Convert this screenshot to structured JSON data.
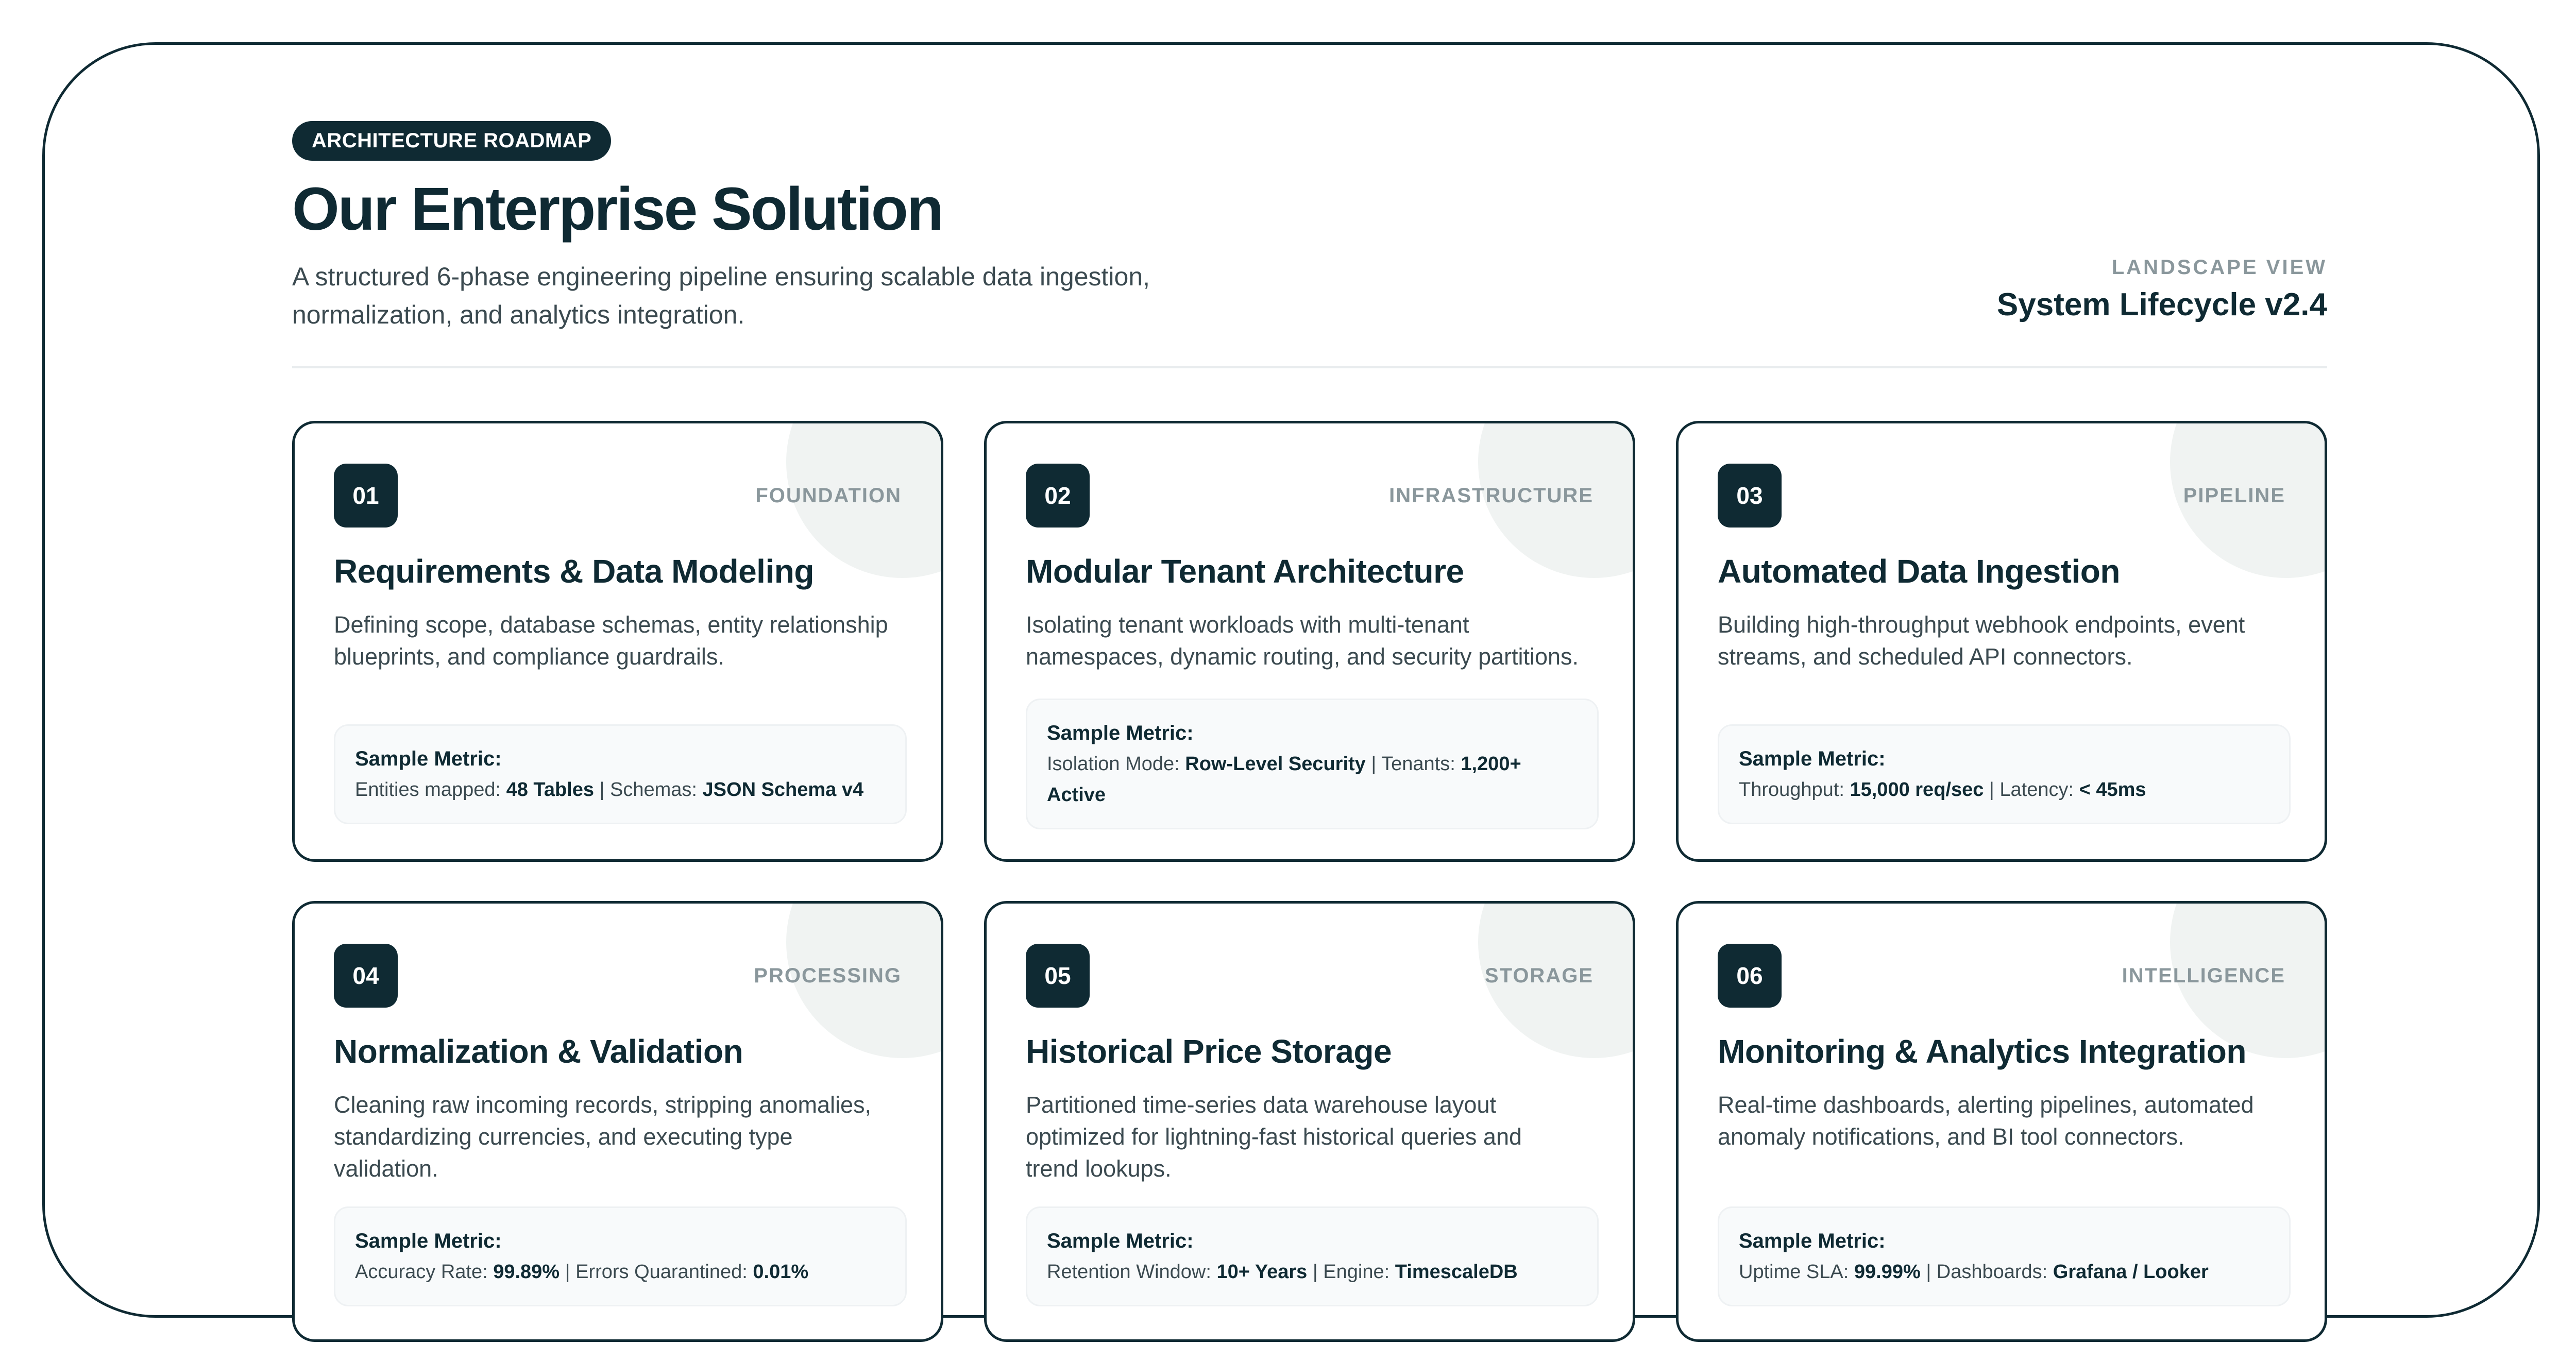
{
  "header": {
    "badge": "ARCHITECTURE ROADMAP",
    "title": "Our Enterprise Solution",
    "subtitle_line1": "A structured 6-phase engineering pipeline ensuring scalable data ingestion,",
    "subtitle_line2": "normalization, and analytics integration.",
    "view_label": "LANDSCAPE VIEW",
    "lifecycle": "System Lifecycle v2.4"
  },
  "cards": [
    {
      "num": "01",
      "category": "FOUNDATION",
      "title": "Requirements & Data Modeling",
      "desc_line1": "Defining scope, database schemas, entity relationship",
      "desc_line2": "blueprints, and compliance guardrails.",
      "metric_label": "Sample Metric:",
      "m1_label": "Entities mapped: ",
      "m1_value": "48 Tables",
      "sep": " | ",
      "m2_label": "Schemas: ",
      "m2_value": "JSON Schema v4"
    },
    {
      "num": "02",
      "category": "INFRASTRUCTURE",
      "title": "Modular Tenant Architecture",
      "desc_line1": "Isolating tenant workloads with multi-tenant",
      "desc_line2": "namespaces, dynamic routing, and security partitions.",
      "metric_label": "Sample Metric:",
      "m1_label": "Isolation Mode: ",
      "m1_value": "Row-Level Security",
      "sep": " | ",
      "m2_label": "Tenants: ",
      "m2_value": "1,200+ Active"
    },
    {
      "num": "03",
      "category": "PIPELINE",
      "title": "Automated Data Ingestion",
      "desc_line1": "Building high-throughput webhook endpoints, event",
      "desc_line2": "streams, and scheduled API connectors.",
      "metric_label": "Sample Metric:",
      "m1_label": "Throughput: ",
      "m1_value": "15,000 req/sec",
      "sep": " | ",
      "m2_label": "Latency: ",
      "m2_value": "< 45ms"
    },
    {
      "num": "04",
      "category": "PROCESSING",
      "title": "Normalization & Validation",
      "desc_line1": "Cleaning raw incoming records, stripping anomalies,",
      "desc_line2": "standardizing currencies, and executing type",
      "desc_line3": "validation.",
      "metric_label": "Sample Metric:",
      "m1_label": "Accuracy Rate: ",
      "m1_value": "99.89%",
      "sep": " | ",
      "m2_label": "Errors Quarantined: ",
      "m2_value": "0.01%"
    },
    {
      "num": "05",
      "category": "STORAGE",
      "title": "Historical Price Storage",
      "desc_line1": "Partitioned time-series data warehouse layout",
      "desc_line2": "optimized for lightning-fast historical queries and",
      "desc_line3": "trend lookups.",
      "metric_label": "Sample Metric:",
      "m1_label": "Retention Window: ",
      "m1_value": "10+ Years",
      "sep": " | ",
      "m2_label": "Engine: ",
      "m2_value": "TimescaleDB"
    },
    {
      "num": "06",
      "category": "INTELLIGENCE",
      "title": "Monitoring & Analytics Integration",
      "desc_line1": "Real-time dashboards, alerting pipelines, automated",
      "desc_line2": "anomaly notifications, and BI tool connectors.",
      "metric_label": "Sample Metric:",
      "m1_label": "Uptime SLA: ",
      "m1_value": "99.99%",
      "sep": " | ",
      "m2_label": "Dashboards: ",
      "m2_value": "Grafana / Looker"
    }
  ]
}
